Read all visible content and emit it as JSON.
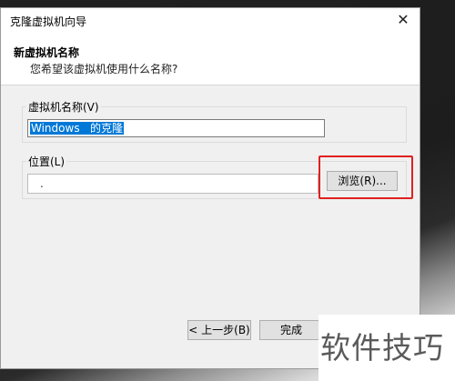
{
  "window": {
    "title": "克隆虚拟机向导",
    "close_glyph": "✕"
  },
  "header": {
    "title": "新虚拟机名称",
    "subtitle": "您希望该虚拟机使用什么名称?"
  },
  "name_group": {
    "label": "虚拟机名称(V)",
    "value": "Windows   的克隆"
  },
  "location_group": {
    "label": "位置(L)",
    "value": "."
  },
  "buttons": {
    "browse": "浏览(R)...",
    "back": "< 上一步(B)",
    "finish": "完成"
  },
  "watermark": "软件技巧",
  "colors": {
    "selection": "#0078d7",
    "highlight_box": "#e02020"
  }
}
